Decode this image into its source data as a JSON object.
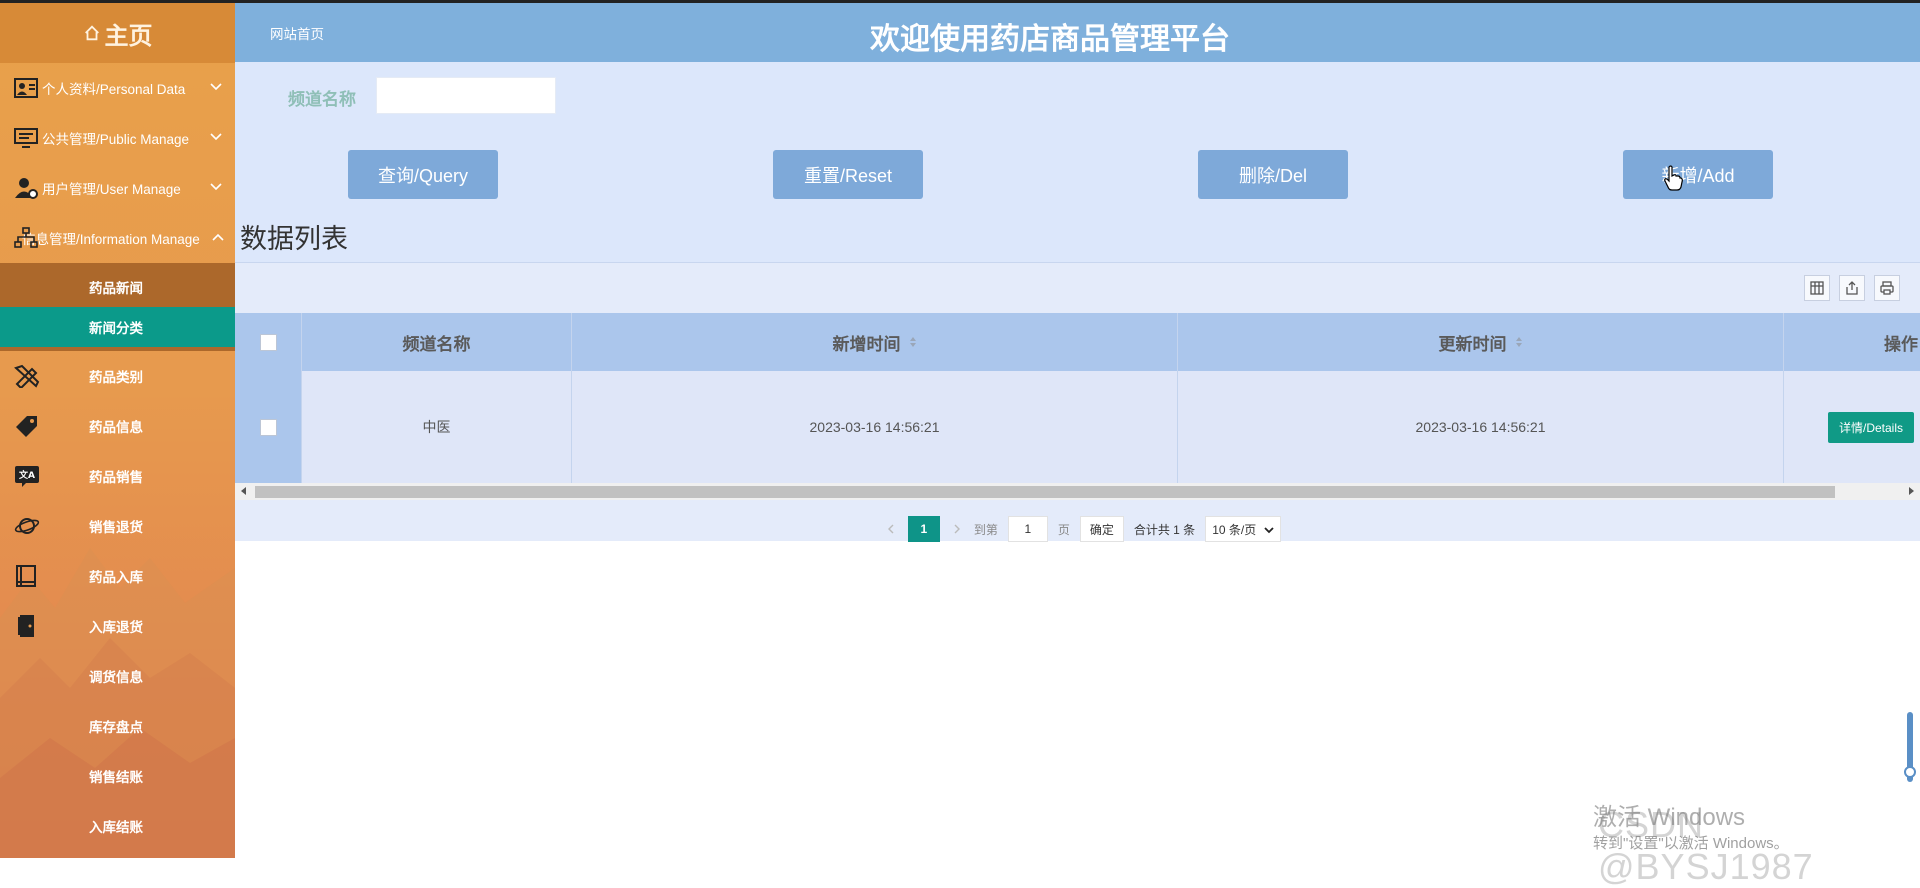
{
  "sidebar": {
    "home": "主页",
    "menus": [
      {
        "label": "个人资料/Personal Data",
        "icon": "user-card-icon"
      },
      {
        "label": "公共管理/Public Manage",
        "icon": "monitor-list-icon"
      },
      {
        "label": "用户管理/User Manage",
        "icon": "user-gear-icon"
      },
      {
        "label": "信息管理/Information Manage",
        "icon": "sitemap-icon"
      }
    ],
    "submenu": [
      "药品新闻",
      "新闻分类"
    ],
    "nav": [
      {
        "label": "药品类别",
        "icon": "pencil-ruler-icon"
      },
      {
        "label": "药品信息",
        "icon": "tag-icon"
      },
      {
        "label": "药品销售",
        "icon": "translate-icon"
      },
      {
        "label": "销售退货",
        "icon": "planet-icon"
      },
      {
        "label": "药品入库",
        "icon": "book-icon"
      },
      {
        "label": "入库退货",
        "icon": "door-icon"
      },
      {
        "label": "调货信息",
        "icon": ""
      },
      {
        "label": "库存盘点",
        "icon": ""
      },
      {
        "label": "销售结账",
        "icon": ""
      },
      {
        "label": "入库结账",
        "icon": ""
      }
    ]
  },
  "header": {
    "breadcrumb": "网站首页",
    "title": "欢迎使用药店商品管理平台"
  },
  "search": {
    "label": "频道名称",
    "value": ""
  },
  "buttons": {
    "query": "查询/Query",
    "reset": "重置/Reset",
    "delete": "删除/Del",
    "add": "新增/Add"
  },
  "list": {
    "title": "数据列表",
    "columns": [
      "频道名称",
      "新增时间",
      "更新时间",
      "操作"
    ],
    "rows": [
      {
        "name": "中医",
        "created": "2023-03-16 14:56:21",
        "updated": "2023-03-16 14:56:21",
        "action": "详情/Details"
      }
    ]
  },
  "pager": {
    "current_page": "1",
    "goto_label": "到第",
    "goto_value": "1",
    "page_unit": "页",
    "confirm": "确定",
    "total": "合计共 1 条",
    "page_size": "10 条/页"
  },
  "watermarks": {
    "activate_title": "激活 Windows",
    "activate_sub": "转到\"设置\"以激活 Windows。",
    "csdn": "CSDN @BYSJ1987"
  },
  "colors": {
    "header": "#7fb0dc",
    "panel": "#dce7fb",
    "button": "#7ea9d9",
    "accent_teal": "#0b9a8a",
    "sidebar_orange": "#e79a4e"
  }
}
